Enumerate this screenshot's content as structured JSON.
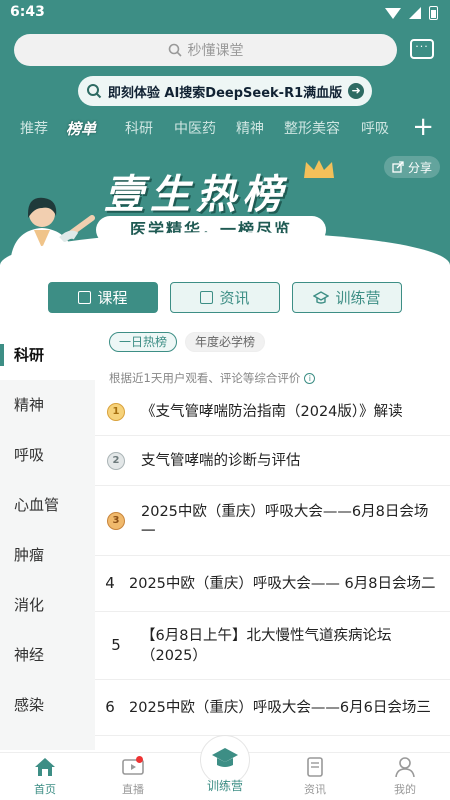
{
  "status": {
    "time": "6:43"
  },
  "search": {
    "placeholder": "秒懂课堂"
  },
  "ai_banner": {
    "text": "即刻体验 AI搜索DeepSeek-R1满血版"
  },
  "category_tabs": [
    "推荐",
    "榜单",
    "科研",
    "中医药",
    "精神",
    "整形美容",
    "呼吸"
  ],
  "active_category": "榜单",
  "hero": {
    "share_label": "分享",
    "title": "壹生热榜",
    "subtitle": "医学精华，一榜尽览"
  },
  "type_tabs": [
    "课程",
    "资讯",
    "训练营"
  ],
  "sidebar": [
    "科研",
    "精神",
    "呼吸",
    "心血管",
    "肿瘤",
    "消化",
    "神经",
    "感染"
  ],
  "filter_pills": [
    "一日热榜",
    "年度必学榜"
  ],
  "note": "根据近1天用户观看、评论等综合评价",
  "ranking": [
    {
      "rank": "1",
      "title": "《支气管哮喘防治指南（2024版）》解读"
    },
    {
      "rank": "2",
      "title": "支气管哮喘的诊断与评估"
    },
    {
      "rank": "3",
      "title": "2025中欧（重庆）呼吸大会——6月8日会场一"
    },
    {
      "rank": "4",
      "title": "2025中欧（重庆）呼吸大会—— 6月8日会场二"
    },
    {
      "rank": "5",
      "title": "【6月8日上午】北大慢性气道疾病论坛（2025）"
    },
    {
      "rank": "6",
      "title": "2025中欧（重庆）呼吸大会——6月6日会场三"
    }
  ],
  "bottom_nav": {
    "home": "首页",
    "live": "直播",
    "camp": "训练营",
    "news": "资讯",
    "me": "我的"
  },
  "colors": {
    "primary": "#3d8e85",
    "accent_red": "#e33333"
  }
}
